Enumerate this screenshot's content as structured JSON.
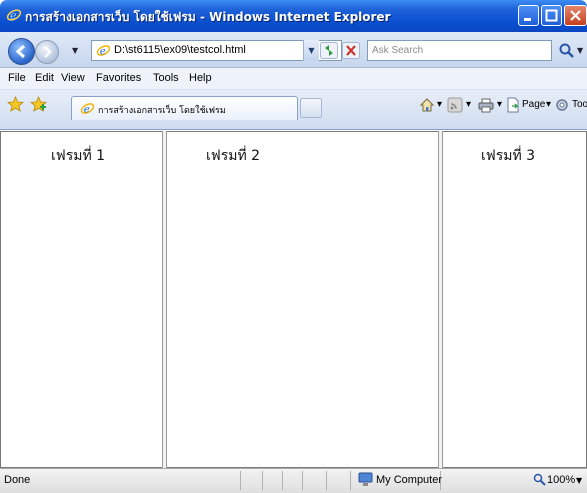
{
  "window": {
    "title": "การสร้างเอกสารเว็บ โดยใช้เฟรม - Windows Internet Explorer"
  },
  "addressbar": {
    "url": "D:\\st6115\\ex09\\testcol.html",
    "search_placeholder": "Ask Search"
  },
  "menubar": {
    "items": [
      "File",
      "Edit",
      "View",
      "Favorites",
      "Tools",
      "Help"
    ]
  },
  "tabs": [
    {
      "label": "การสร้างเอกสารเว็บ โดยใช้เฟรม"
    }
  ],
  "toolbar": {
    "page_label": "Page",
    "tools_label": "Tools",
    "chevron": "»"
  },
  "frames": [
    {
      "label": "เฟรมที่ 1"
    },
    {
      "label": "เฟรมที่ 2"
    },
    {
      "label": "เฟรมที่ 3"
    }
  ],
  "statusbar": {
    "status_text": "Done",
    "zone": "My Computer",
    "zoom": "100%"
  },
  "colors": {
    "titlebar": "#0a4fd0",
    "chrome": "#c7d6ee",
    "frame_border": "#9a9a9a"
  },
  "icons": [
    "ie-icon",
    "minimize-icon",
    "maximize-icon",
    "close-icon",
    "back-icon",
    "forward-icon",
    "refresh-icon",
    "stop-icon",
    "search-icon",
    "favorites-star-icon",
    "add-favorites-icon",
    "home-icon",
    "feeds-icon",
    "print-icon",
    "page-icon",
    "tools-gear-icon",
    "computer-icon",
    "zoom-icon"
  ]
}
